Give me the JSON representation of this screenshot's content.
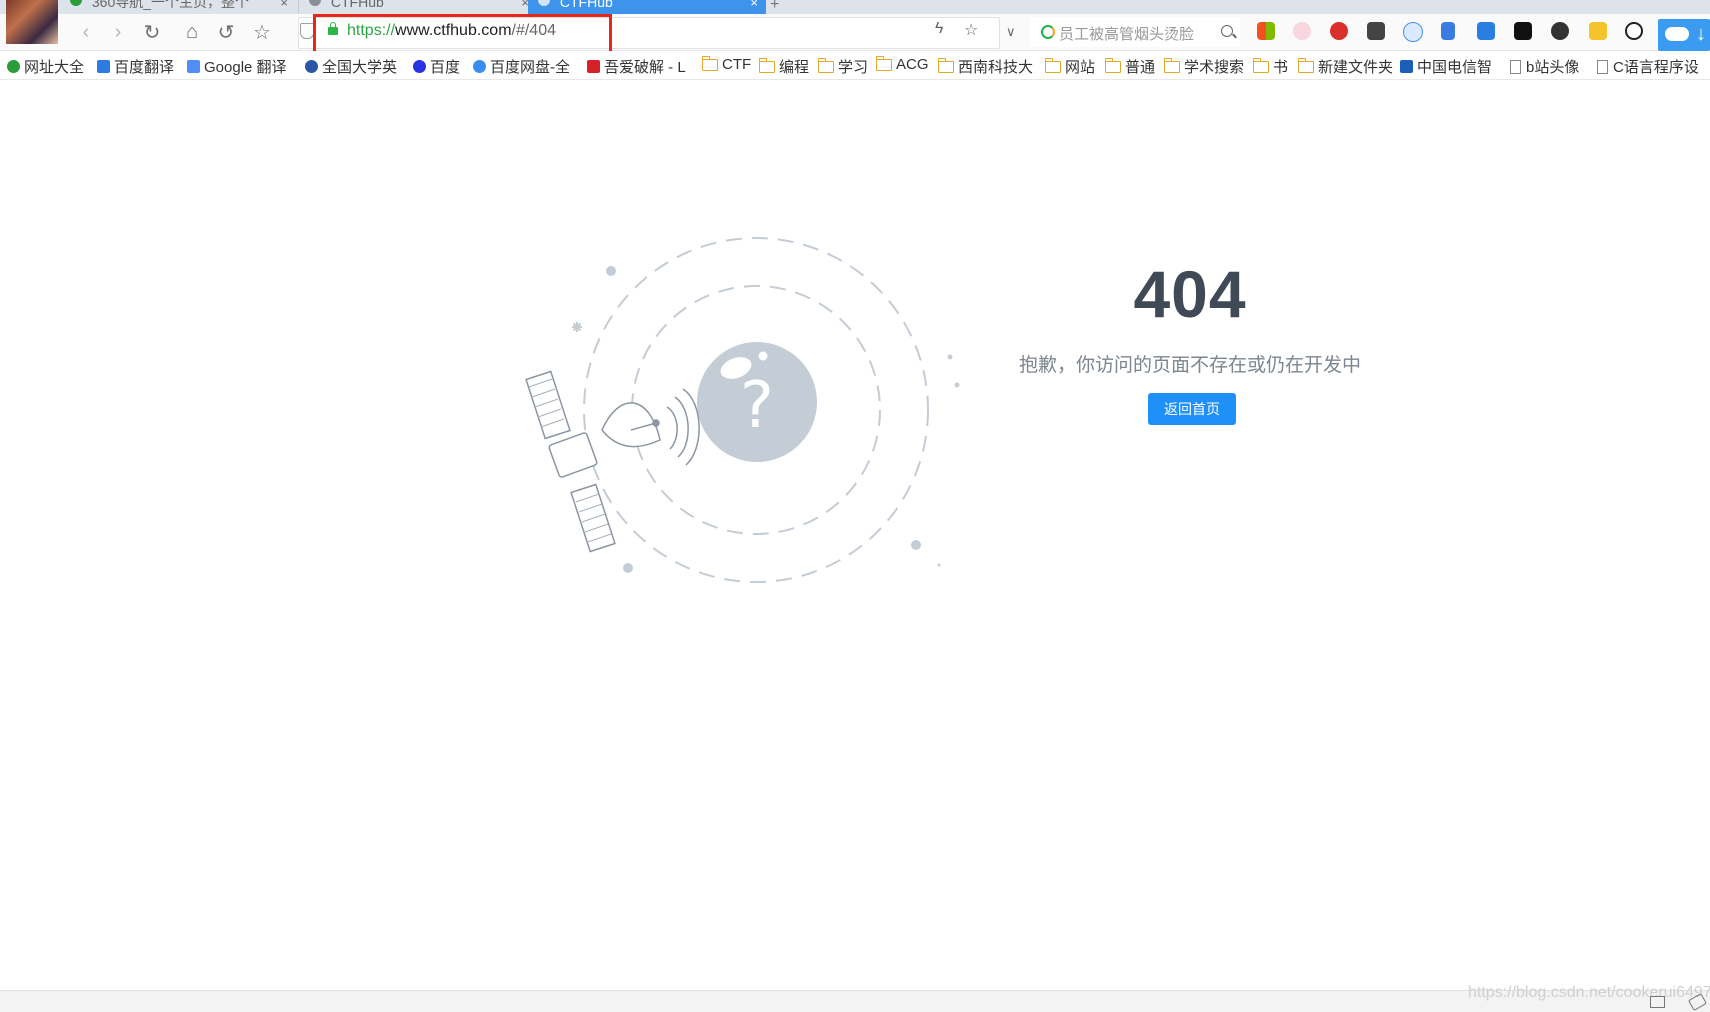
{
  "browser": {
    "tabs": [
      {
        "label": "360导航_一个主页，整个",
        "active": false
      },
      {
        "label": "CTFHub",
        "active": false
      },
      {
        "label": "CTFHub",
        "active": true
      }
    ],
    "address": {
      "scheme": "https://",
      "host": "www.ctfhub.com",
      "path": "/#/404"
    },
    "search": {
      "placeholder": "员工被高管烟头烫脸"
    },
    "bookmarks": [
      {
        "label": "网址大全",
        "kind": "site"
      },
      {
        "label": "百度翻译",
        "kind": "site"
      },
      {
        "label": "Google 翻译",
        "kind": "site"
      },
      {
        "label": "全国大学英",
        "kind": "site"
      },
      {
        "label": "百度",
        "kind": "site"
      },
      {
        "label": "百度网盘-全",
        "kind": "site"
      },
      {
        "label": "吾爱破解 - L",
        "kind": "site"
      },
      {
        "label": "CTF",
        "kind": "folder"
      },
      {
        "label": "编程",
        "kind": "folder"
      },
      {
        "label": "学习",
        "kind": "folder"
      },
      {
        "label": "ACG",
        "kind": "folder"
      },
      {
        "label": "西南科技大",
        "kind": "folder"
      },
      {
        "label": "网站",
        "kind": "folder"
      },
      {
        "label": "普通",
        "kind": "folder"
      },
      {
        "label": "学术搜索",
        "kind": "folder"
      },
      {
        "label": "书",
        "kind": "folder"
      },
      {
        "label": "新建文件夹",
        "kind": "folder"
      },
      {
        "label": "中国电信智",
        "kind": "site"
      },
      {
        "label": "b站头像",
        "kind": "page"
      },
      {
        "label": "C语言程序设",
        "kind": "page"
      }
    ],
    "colors": {
      "accent": "#3e93ea",
      "highlight_box": "#e8261c",
      "secure": "#2fb44a"
    }
  },
  "page": {
    "error_code": "404",
    "message": "抱歉，你访问的页面不存在或仍在开发中",
    "home_button": "返回首页",
    "colors": {
      "primary": "#1f90f8",
      "heading": "#404a56",
      "text": "#7d8590",
      "illustration": "#c4ccd5"
    }
  },
  "watermark": "https://blog.csdn.net/cookerui6497"
}
